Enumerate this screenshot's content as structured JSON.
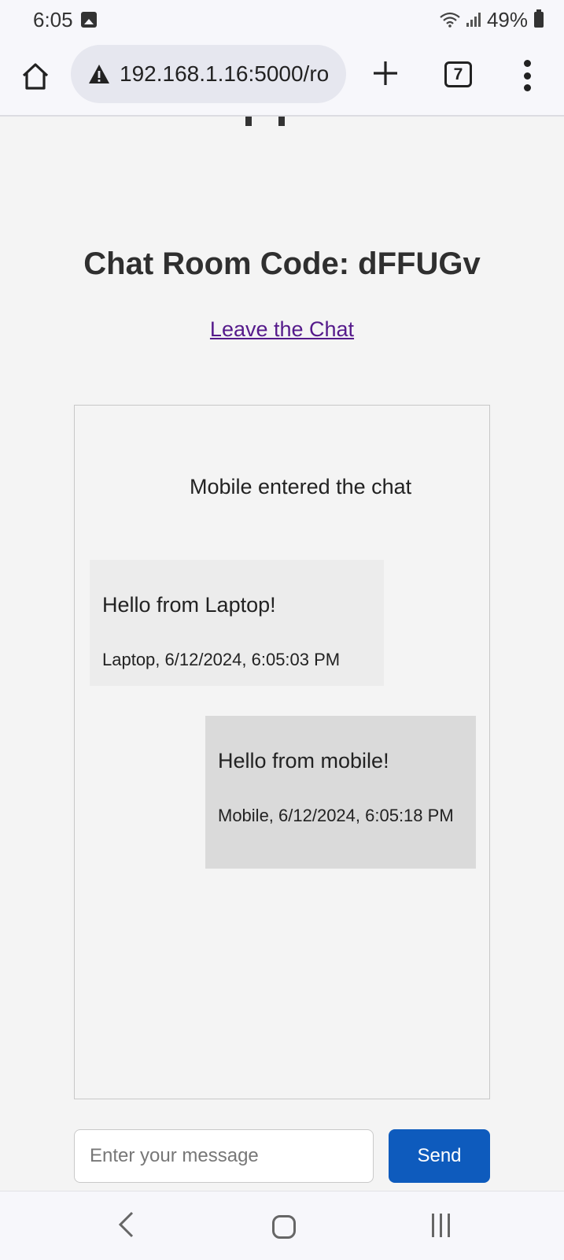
{
  "status_bar": {
    "time": "6:05",
    "battery": "49%",
    "icons": [
      "gallery-icon",
      "wifi-icon",
      "signal-icon",
      "battery-icon"
    ]
  },
  "browser": {
    "url": "192.168.1.16:5000/ro",
    "tab_count": "7",
    "icons": [
      "home-icon",
      "warning-icon",
      "plus-icon",
      "tabs-icon",
      "more-vert-icon"
    ]
  },
  "chat": {
    "room_title": "Chat Room Code: dFFUGv",
    "leave_link": "Leave the Chat",
    "system_message": "Mobile entered the chat",
    "messages": [
      {
        "text": "Hello from Laptop!",
        "meta": "Laptop, 6/12/2024, 6:05:03 PM"
      },
      {
        "text": "Hello from mobile!",
        "meta": "Mobile, 6/12/2024, 6:05:18 PM"
      }
    ],
    "input_placeholder": "Enter your message",
    "send_label": "Send"
  },
  "nav_bar": {
    "icons": [
      "back-icon",
      "home-circle-icon",
      "recents-icon"
    ]
  },
  "colors": {
    "send_button": "#0e5bbd",
    "link": "#551a8b",
    "laptop_bubble": "#ececec",
    "mobile_bubble": "#dadada"
  }
}
